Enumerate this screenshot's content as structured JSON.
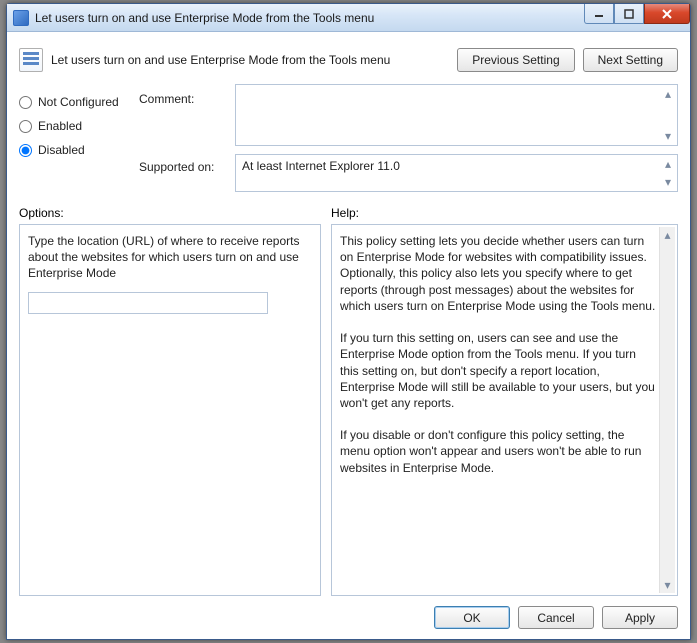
{
  "window": {
    "title": "Let users turn on and use Enterprise Mode from the Tools menu"
  },
  "header": {
    "title": "Let users turn on and use Enterprise Mode from the Tools menu",
    "previous_label": "Previous Setting",
    "next_label": "Next Setting"
  },
  "state": {
    "options": [
      {
        "id": "not_configured",
        "label": "Not Configured",
        "checked": false
      },
      {
        "id": "enabled",
        "label": "Enabled",
        "checked": false
      },
      {
        "id": "disabled",
        "label": "Disabled",
        "checked": true
      }
    ],
    "comment_label": "Comment:",
    "comment_value": "",
    "supported_label": "Supported on:",
    "supported_value": "At least Internet Explorer 11.0"
  },
  "sections": {
    "options_label": "Options:",
    "help_label": "Help:"
  },
  "options_panel": {
    "description": "Type the location (URL) of where to receive reports about the websites for which users turn on and use Enterprise Mode",
    "url_value": ""
  },
  "help_panel": {
    "text": "This policy setting lets you decide whether users can turn on Enterprise Mode for websites with compatibility issues. Optionally, this policy also lets you specify where to get reports (through post messages) about the websites for which users turn on Enterprise Mode using the Tools menu.\n\nIf you turn this setting on, users can see and use the Enterprise Mode option from the Tools menu. If you turn this setting on, but don't specify a report location, Enterprise Mode will still be available to your users, but you won't get any reports.\n\nIf you disable or don't configure this policy setting, the menu option won't appear and users won't be able to run websites in Enterprise Mode."
  },
  "footer": {
    "ok_label": "OK",
    "cancel_label": "Cancel",
    "apply_label": "Apply"
  }
}
